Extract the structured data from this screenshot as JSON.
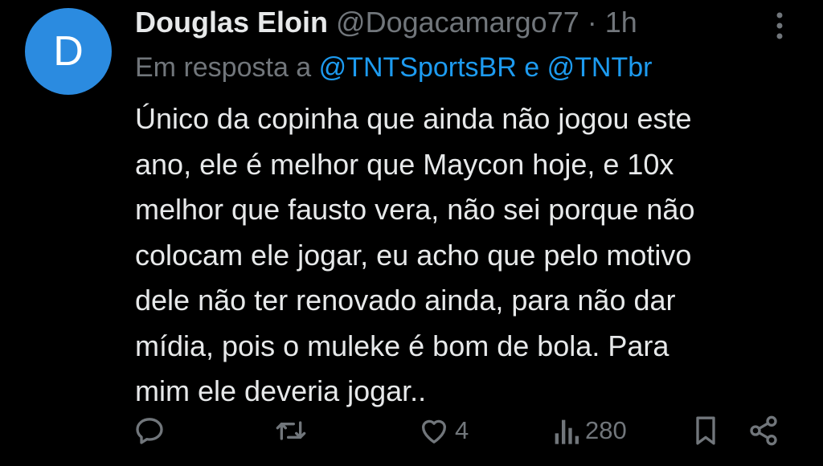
{
  "author": {
    "avatar_letter": "D",
    "avatar_color": "#2b8be0",
    "name": "Douglas Eloin",
    "handle": "@Dogacamargo77",
    "separator": "·",
    "time": "1h"
  },
  "reply_context": {
    "prefix": "Em resposta a",
    "mention1": "@TNTSportsBR",
    "conjunction": "e",
    "mention2": "@TNTbr"
  },
  "tweet": {
    "lines": [
      "Único da copinha que ainda não jogou este",
      "ano, ele é melhor que Maycon hoje, e 10x",
      "melhor que fausto vera, não sei porque não",
      "colocam ele jogar, eu acho que pelo motivo",
      "dele não ter renovado ainda, para não dar",
      "mídia, pois o muleke é bom de bola. Para",
      "mim ele deveria jogar.."
    ]
  },
  "actions": {
    "reply_icon": "reply-icon",
    "retweet_icon": "retweet-icon",
    "like_icon": "heart-icon",
    "like_count": "4",
    "views_icon": "views-icon",
    "views_count": "280",
    "bookmark_icon": "bookmark-icon",
    "share_icon": "share-icon"
  },
  "colors": {
    "background": "#000000",
    "text": "#e7e9ea",
    "secondary": "#71767b",
    "link": "#1d9bf0"
  }
}
